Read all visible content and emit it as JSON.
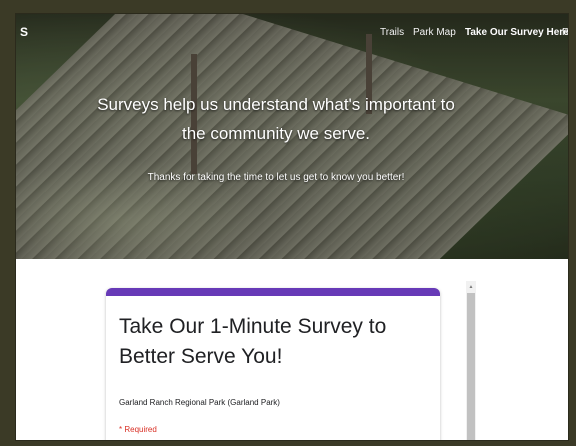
{
  "nav": {
    "brand": "S",
    "items": [
      {
        "label": "Trails"
      },
      {
        "label": "Park Map"
      },
      {
        "label": "Take Our Survey Here!"
      },
      {
        "label": "R"
      }
    ],
    "active_index": 2
  },
  "hero": {
    "headline": "Surveys help us understand what's important to the community we serve.",
    "subtext": "Thanks for taking the time to let us get to know you better!"
  },
  "form": {
    "title": "Take Our 1-Minute Survey to Better Serve You!",
    "description": "Garland Ranch Regional Park (Garland Park)",
    "required_note": "* Required",
    "accent_color": "#673ab7"
  },
  "scrollbar": {
    "up_arrow_icon": "chevron-up-icon"
  }
}
